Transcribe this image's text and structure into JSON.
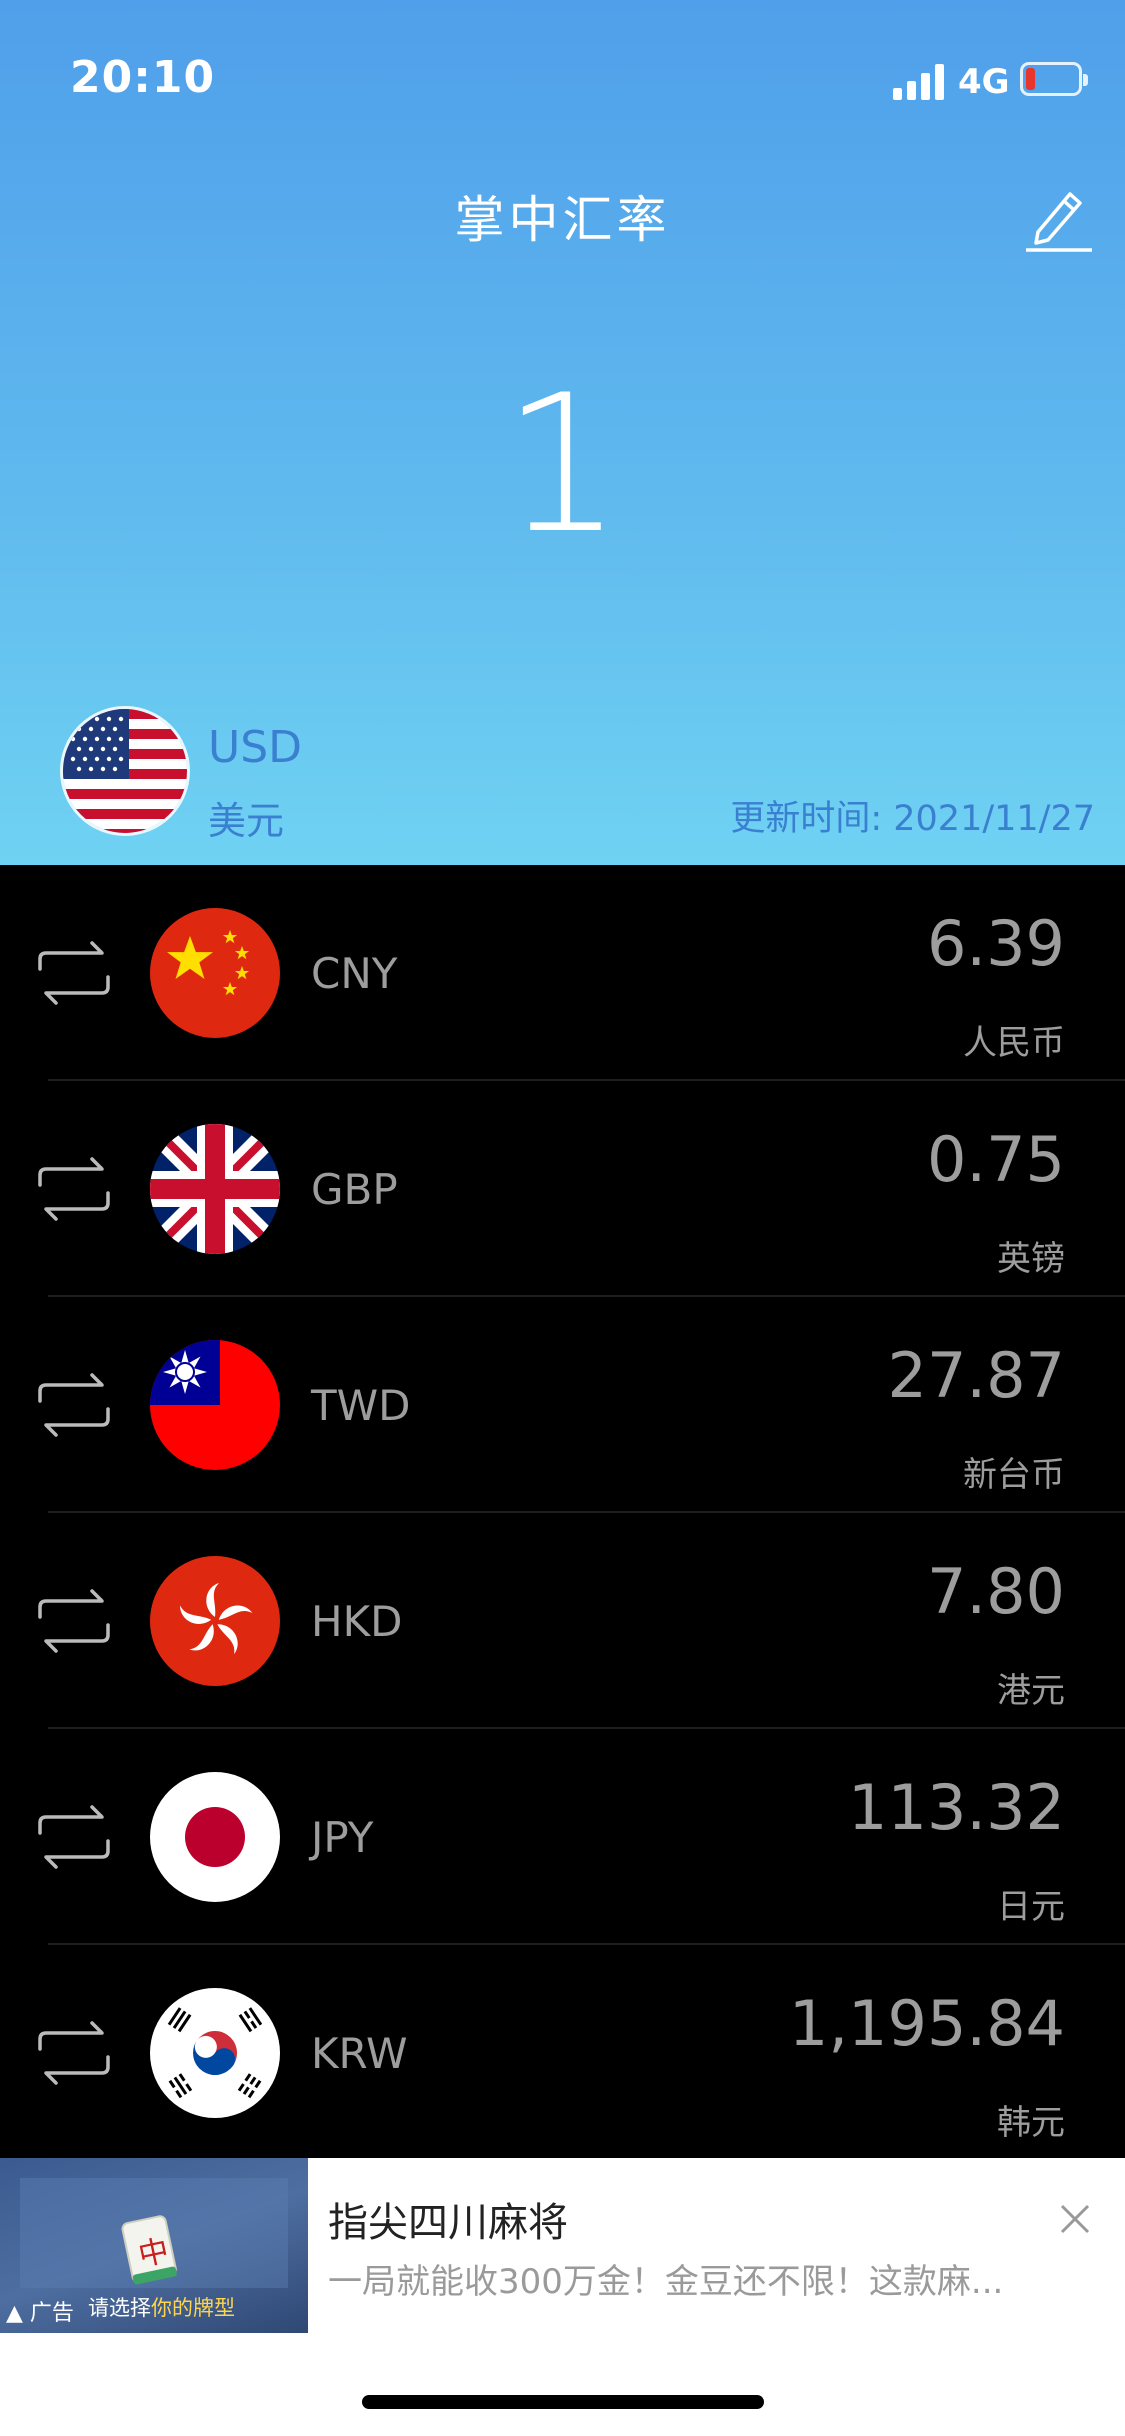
{
  "status_bar": {
    "time": "20:10",
    "network": "4G"
  },
  "header": {
    "title": "掌中汇率",
    "amount": "1"
  },
  "base_currency": {
    "code": "USD",
    "name": "美元",
    "update_label": "更新时间: 2021/11/27"
  },
  "rates": [
    {
      "code": "CNY",
      "value": "6.39",
      "name": "人民币",
      "flag": "china-flag-icon"
    },
    {
      "code": "GBP",
      "value": "0.75",
      "name": "英镑",
      "flag": "uk-flag-icon"
    },
    {
      "code": "TWD",
      "value": "27.87",
      "name": "新台币",
      "flag": "taiwan-flag-icon"
    },
    {
      "code": "HKD",
      "value": "7.80",
      "name": "港元",
      "flag": "hongkong-flag-icon"
    },
    {
      "code": "JPY",
      "value": "113.32",
      "name": "日元",
      "flag": "japan-flag-icon"
    },
    {
      "code": "KRW",
      "value": "1,195.84",
      "name": "韩元",
      "flag": "korea-flag-icon"
    }
  ],
  "ad": {
    "title": "指尖四川麻将",
    "description": "一局就能收300万金！金豆还不限！这款麻...",
    "label": "广告",
    "caption_prefix": "请选择",
    "caption_highlight": "你的牌型",
    "tile_char": "中"
  },
  "colors": {
    "header_top": "#4f9fea",
    "header_bottom": "#6fd2f2",
    "text_muted": "#9d9d9d",
    "accent_text": "#3a7fd0"
  }
}
